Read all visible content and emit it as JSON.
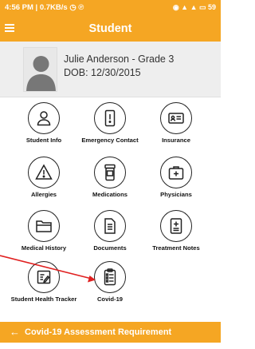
{
  "status_bar": {
    "left_text": "4:56 PM | 0.7KB/s ◷ ℗",
    "right_text": "◉ ▲ ▲ ▭ 59"
  },
  "app_bar": {
    "title": "Student",
    "menu_icon": "hamburger-menu-icon"
  },
  "profile": {
    "name": "Julie Anderson - Grade 3",
    "dob": "DOB: 12/30/2015"
  },
  "tiles": [
    {
      "label": "Student Info",
      "icon": "person-icon"
    },
    {
      "label": "Emergency Contact",
      "icon": "phone-alert-icon"
    },
    {
      "label": "Insurance",
      "icon": "card-icon"
    },
    {
      "label": "Allergies",
      "icon": "warning-icon"
    },
    {
      "label": "Medications",
      "icon": "pill-bottle-icon"
    },
    {
      "label": "Physicians",
      "icon": "medical-bag-icon"
    },
    {
      "label": "Medical History",
      "icon": "folder-icon"
    },
    {
      "label": "Documents",
      "icon": "document-icon"
    },
    {
      "label": "Treatment Notes",
      "icon": "clipboard-plus-icon"
    },
    {
      "label": "Student Health Tracker",
      "icon": "edit-note-icon"
    },
    {
      "label": "Covid-19",
      "icon": "checklist-icon"
    }
  ],
  "bottom_bar": {
    "back_glyph": "←",
    "text": "Covid-19 Assessment Requirement"
  },
  "colors": {
    "accent": "#f5a623",
    "annotation_arrow": "#e02020"
  }
}
